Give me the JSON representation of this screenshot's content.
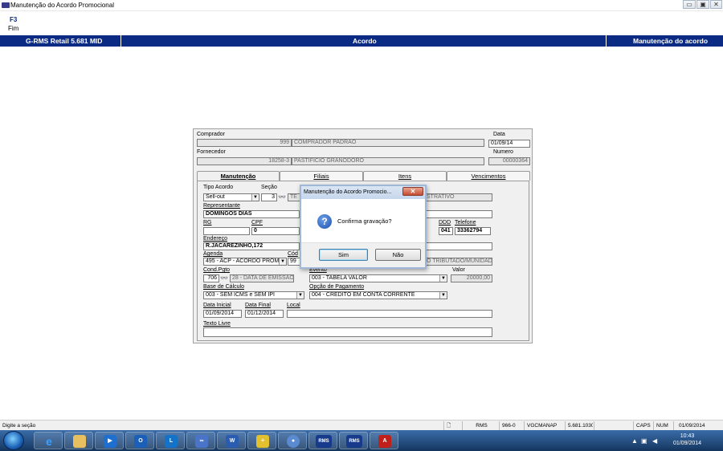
{
  "window": {
    "title": "Manutenção do Acordo Promocional",
    "btn_min": "▭",
    "btn_max": "▣",
    "btn_close": "✕"
  },
  "toolbar": {
    "key": "F3",
    "label": "Fim"
  },
  "header": {
    "left": "G-RMS Retail 5.681 MID",
    "center": "Acordo",
    "right": "Manutenção do acordo",
    "bg": "#0b2a83"
  },
  "form": {
    "comprador_label": "Comprador",
    "comprador_code": "999",
    "comprador_name": "COMPRADOR PADRAO",
    "data_label": "Data",
    "data_value": "01/09/14",
    "fornecedor_label": "Fornecedor",
    "fornecedor_code": "18258-3",
    "fornecedor_name": "PASTIFICIO GRANODORO",
    "numero_label": "Numero",
    "numero_value": "00000364"
  },
  "tabs": [
    "Manutenção",
    "Filiais",
    "Itens",
    "Vencimentos"
  ],
  "manut": {
    "tipo_label": "Tipo Acordo",
    "tipo_value": "Sell-out",
    "secao_label": "Seção",
    "secao_value": "3",
    "secao_desc": "TE",
    "secao_desc_right": "STRATIVO",
    "rep_label": "Representante",
    "rep_value": "DOMINGOS DIAS",
    "rg_label": "RG",
    "rg_value": "",
    "cpf_label": "CPF",
    "cpf_value": "0",
    "ddd_label": "DDD",
    "ddd_value": "041",
    "tel_label": "Telefone",
    "tel_value": "33362794",
    "end_label": "Endereço",
    "end_value": "R.JACAREZINHO,172",
    "agenda_label": "Agenda",
    "agenda_value": "495 - ACP - ACORDO PROMO",
    "cod_label": "Cód",
    "cod_value": "99",
    "trib_value": "O TRIBUTADO/MUNIDADE",
    "cond_label": "Cond.Pgto",
    "cond_code": "706",
    "cond_desc": "28 - DATA DE EMISSAO",
    "evento_label": "Evento",
    "evento_value": "003 - TABELA VALOR",
    "valor_label": "Valor",
    "valor_value": "20000,00",
    "base_label": "Base de Cálculo",
    "base_value": "003 - SEM ICMS e SEM IPI",
    "opcao_label": "Opção de Pagamento",
    "opcao_value": "004 - CRÉDITO EM CONTA CORRENTE",
    "dini_label": "Data Inicial",
    "dini_value": "01/09/2014",
    "dfim_label": "Data Final",
    "dfim_value": "01/12/2014",
    "local_label": "Local",
    "local_value": "",
    "texto_label": "Texto Livre",
    "texto_value": ""
  },
  "dialog": {
    "title": "Manutenção do Acordo Promocio...",
    "close": "✕",
    "icon": "?",
    "message": "Confirma gravação?",
    "yes": "Sim",
    "no": "Não"
  },
  "status": {
    "message": "Digite a seção",
    "rms": "RMS",
    "code": "966-0",
    "user": "VGCMANAP",
    "version": "5.681.1030",
    "caps": "CAPS",
    "num": "NUM",
    "date": "01/09/2014"
  },
  "taskbar": {
    "icons": [
      "ie-icon",
      "explorer-icon",
      "media-player-icon",
      "outlook-icon",
      "lync-icon",
      "app-icon",
      "word-icon",
      "app-icon",
      "app-icon",
      "rms-icon",
      "rms-icon",
      "acrobat-icon"
    ],
    "rms1": "RMS",
    "rms2": "RMS",
    "time": "10:43",
    "date": "01/09/2014",
    "tray_up": "▲",
    "tray_net": "▣",
    "tray_vol": "◀"
  }
}
